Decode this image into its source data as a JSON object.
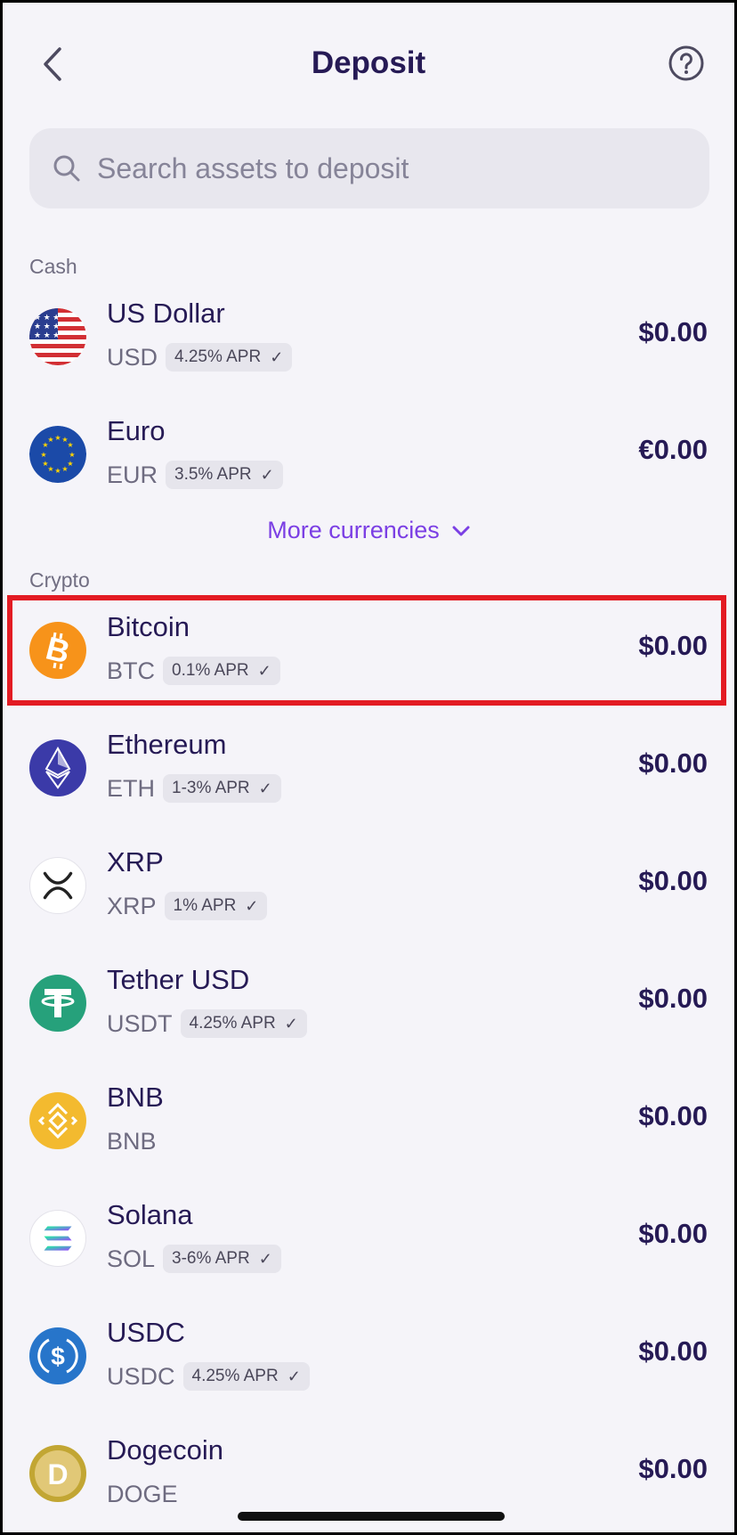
{
  "header": {
    "title": "Deposit",
    "back_icon": "chevron-left-icon",
    "help_icon": "question-circle-icon"
  },
  "search": {
    "placeholder": "Search assets to deposit",
    "value": ""
  },
  "sections": {
    "cash_label": "Cash",
    "crypto_label": "Crypto"
  },
  "cash": [
    {
      "name": "US Dollar",
      "ticker": "USD",
      "apr": "4.25% APR",
      "amount": "$0.00",
      "icon": "us-flag-icon"
    },
    {
      "name": "Euro",
      "ticker": "EUR",
      "apr": "3.5% APR",
      "amount": "€0.00",
      "icon": "eu-flag-icon"
    }
  ],
  "more_currencies": "More currencies",
  "crypto": [
    {
      "name": "Bitcoin",
      "ticker": "BTC",
      "apr": "0.1% APR",
      "amount": "$0.00",
      "icon": "bitcoin-icon",
      "color": "#f7931a"
    },
    {
      "name": "Ethereum",
      "ticker": "ETH",
      "apr": "1-3% APR",
      "amount": "$0.00",
      "icon": "ethereum-icon",
      "color": "#3b3aa8"
    },
    {
      "name": "XRP",
      "ticker": "XRP",
      "apr": "1% APR",
      "amount": "$0.00",
      "icon": "xrp-icon",
      "color": "#ffffff"
    },
    {
      "name": "Tether USD",
      "ticker": "USDT",
      "apr": "4.25% APR",
      "amount": "$0.00",
      "icon": "tether-icon",
      "color": "#26a17b"
    },
    {
      "name": "BNB",
      "ticker": "BNB",
      "apr": "",
      "amount": "$0.00",
      "icon": "bnb-icon",
      "color": "#f3ba2f"
    },
    {
      "name": "Solana",
      "ticker": "SOL",
      "apr": "3-6% APR",
      "amount": "$0.00",
      "icon": "solana-icon",
      "color": "#ffffff"
    },
    {
      "name": "USDC",
      "ticker": "USDC",
      "apr": "4.25% APR",
      "amount": "$0.00",
      "icon": "usdc-icon",
      "color": "#2775ca"
    },
    {
      "name": "Dogecoin",
      "ticker": "DOGE",
      "apr": "",
      "amount": "$0.00",
      "icon": "dogecoin-icon",
      "color": "#c2a633"
    }
  ],
  "colors": {
    "title": "#261a55",
    "accent": "#7b3fe4",
    "highlight": "#e31b23",
    "background": "#f5f4f9"
  }
}
